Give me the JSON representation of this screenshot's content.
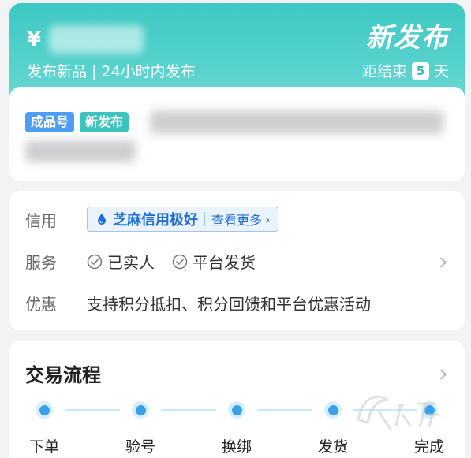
{
  "header": {
    "currency": "¥",
    "badge": "新发布",
    "subtitle_left": "发布新品",
    "subtitle_right": "24小时内发布",
    "countdown_prefix": "距结束",
    "countdown_value": "5",
    "countdown_suffix": "天"
  },
  "product": {
    "tags": [
      "成品号",
      "新发布"
    ]
  },
  "info": {
    "credit_label": "信用",
    "credit_value": "芝麻信用极好",
    "credit_more": "查看更多",
    "service_label": "服务",
    "services": [
      "已实人",
      "平台发货"
    ],
    "promo_label": "优惠",
    "promo_value": "支持积分抵扣、积分回馈和平台优惠活动"
  },
  "process": {
    "title": "交易流程",
    "steps": [
      "下单",
      "验号",
      "换绑",
      "发货",
      "完成"
    ]
  },
  "colors": {
    "header_teal": "#3ec8c3",
    "tag_blue": "#4d9df2",
    "tag_teal": "#3dc3bd",
    "credit_blue": "#1f6fd6",
    "step_blue": "#3aa0ea"
  },
  "icons": {
    "credit": "water-drop-icon",
    "service_check": "check-circle-icon",
    "chevron": "chevron-right-icon"
  }
}
